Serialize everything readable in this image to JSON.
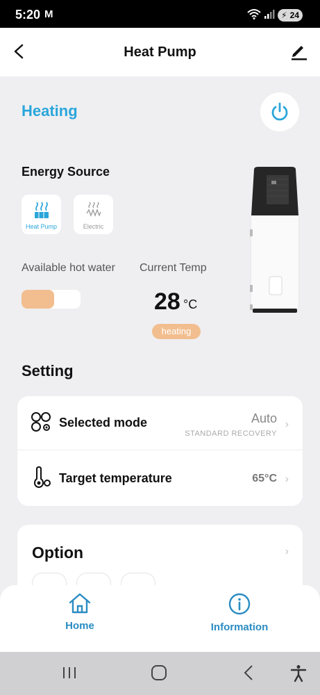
{
  "status_bar": {
    "time": "5:20",
    "mail_icon": "M",
    "battery": "24"
  },
  "app_bar": {
    "title": "Heat Pump",
    "back_icon": "back-arrow-icon",
    "edit_icon": "pencil-icon"
  },
  "status": {
    "mode_label": "Heating",
    "accent": "#2aa6da"
  },
  "energy_source": {
    "title": "Energy Source",
    "options": [
      {
        "label": "Heat Pump",
        "selected": true
      },
      {
        "label": "Electric",
        "selected": false
      }
    ]
  },
  "hot_water": {
    "label": "Available hot water",
    "level_fraction": 0.55,
    "fill_color": "#f2be8f"
  },
  "current_temp": {
    "label": "Current Temp",
    "value": "28",
    "unit": "°C",
    "badge": "heating"
  },
  "setting": {
    "title": "Setting",
    "selected_mode": {
      "label": "Selected mode",
      "value": "Auto",
      "sub": "STANDARD RECOVERY"
    },
    "target_temperature": {
      "label": "Target temperature",
      "value": "65°C"
    }
  },
  "option": {
    "title": "Option"
  },
  "bottom_nav": [
    {
      "label": "Home"
    },
    {
      "label": "Information"
    }
  ]
}
